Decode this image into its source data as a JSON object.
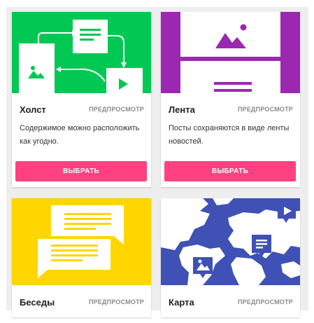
{
  "colors": {
    "canvas": "#00c853",
    "feed": "#9c27b0",
    "talks": "#ffd600",
    "map_sea": "#3f51b5",
    "accent": "#ff4081"
  },
  "cards": [
    {
      "title": "Холст",
      "preview": "ПРЕДПРОСМОТР",
      "description": "Содержимое можно расположить как угодно.",
      "button": "ВЫБРАТЬ"
    },
    {
      "title": "Лента",
      "preview": "ПРЕДПРОСМОТР",
      "description": "Посты сохраняются в виде ленты новостей.",
      "button": "ВЫБРАТЬ"
    },
    {
      "title": "Беседы",
      "preview": "ПРЕДПРОСМОТР"
    },
    {
      "title": "Карта",
      "preview": "ПРЕДПРОСМОТР"
    }
  ],
  "icons": [
    "image-icon",
    "document-icon",
    "play-icon",
    "chat-bubble-icon",
    "map-pin-icon"
  ]
}
